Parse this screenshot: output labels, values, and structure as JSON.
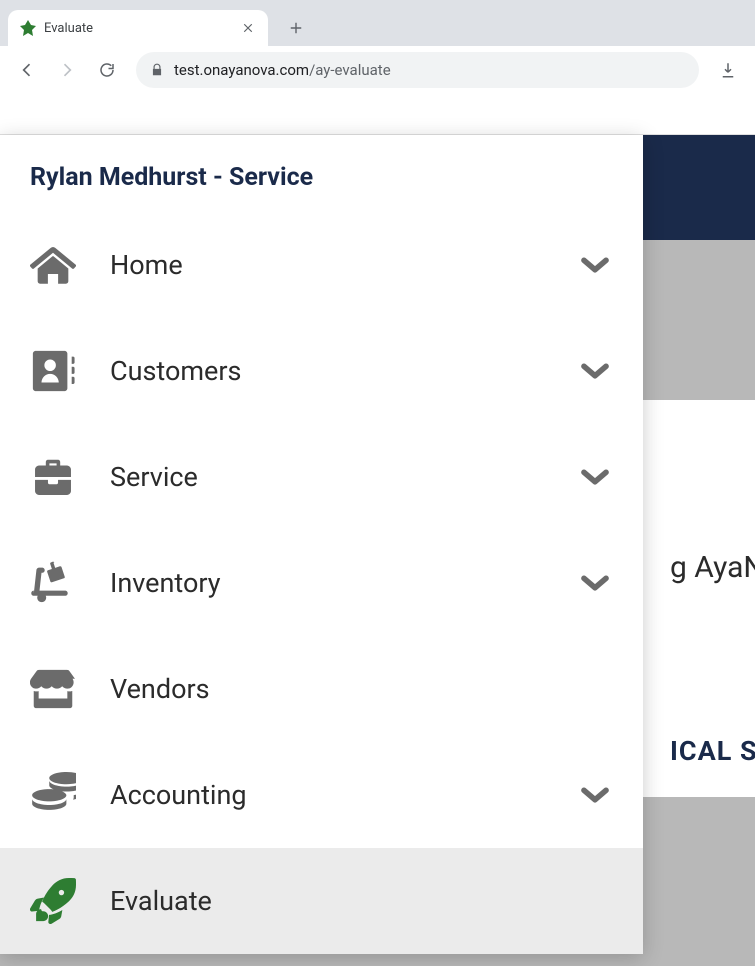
{
  "browser": {
    "tab_title": "Evaluate",
    "url_host": "test.onayanova.com",
    "url_path": "/ay-evaluate"
  },
  "sidebar": {
    "header": "Rylan Medhurst - Service",
    "items": [
      {
        "label": "Home",
        "icon": "home",
        "expandable": true,
        "active": false
      },
      {
        "label": "Customers",
        "icon": "contacts",
        "expandable": true,
        "active": false
      },
      {
        "label": "Service",
        "icon": "toolbox",
        "expandable": true,
        "active": false
      },
      {
        "label": "Inventory",
        "icon": "dolly",
        "expandable": true,
        "active": false
      },
      {
        "label": "Vendors",
        "icon": "store",
        "expandable": false,
        "active": false
      },
      {
        "label": "Accounting",
        "icon": "coins",
        "expandable": true,
        "active": false
      },
      {
        "label": "Evaluate",
        "icon": "rocket",
        "expandable": false,
        "active": true
      }
    ]
  },
  "background": {
    "fragment1": "g AyaNo",
    "fragment2": "ICAL SU"
  }
}
